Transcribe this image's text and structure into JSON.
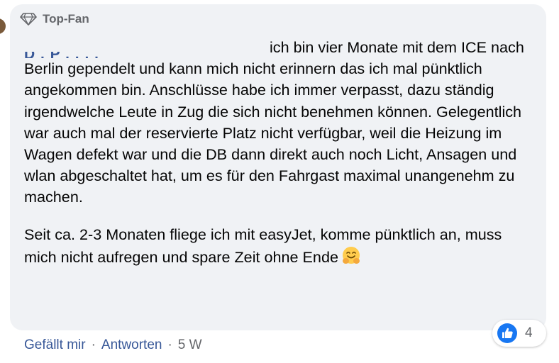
{
  "badge": {
    "label": "Top-Fan",
    "icon": "diamond-icon"
  },
  "comment": {
    "author_partial": "D    .  P  .  .  .  .",
    "paragraph1": "ich bin vier Monate mit dem ICE nach Berlin gependelt und kann mich nicht erinnern das ich mal pünktlich angekommen bin. Anschlüsse habe ich immer verpasst, dazu ständig irgendwelche Leute in Zug die sich nicht benehmen können. Gelegentlich war auch mal der reservierte Platz nicht verfügbar, weil die Heizung im Wagen defekt war und die DB dann direkt auch noch Licht, Ansagen und wlan abgeschaltet hat, um es für den Fahrgast maximal unangenehm zu machen.",
    "paragraph2": "Seit ca. 2-3 Monaten fliege ich mit easyJet, komme pünktlich an, muss mich nicht aufregen und spare Zeit ohne Ende",
    "emoji": "hugging-face-emoji"
  },
  "actions": {
    "like": "Gefällt mir",
    "reply": "Antworten",
    "separator": "·",
    "time": "5 W"
  },
  "reactions": {
    "icon": "like-icon",
    "count": "4"
  },
  "colors": {
    "bubble": "#f0f2f5",
    "link": "#385898",
    "meta": "#65676b",
    "like": "#1877f2"
  }
}
